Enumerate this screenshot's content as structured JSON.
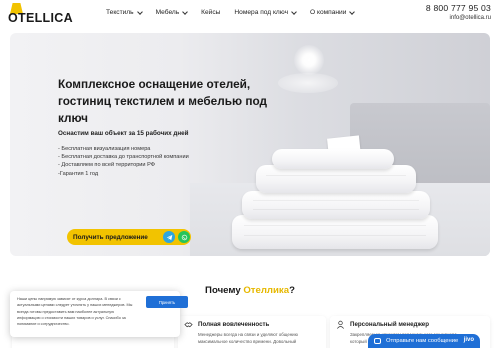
{
  "header": {
    "logo_text": "OTELLICA",
    "nav": [
      {
        "label": "Текстиль",
        "has_dropdown": true
      },
      {
        "label": "Мебель",
        "has_dropdown": true
      },
      {
        "label": "Кейсы",
        "has_dropdown": false
      },
      {
        "label": "Номера под ключ",
        "has_dropdown": true
      },
      {
        "label": "О компании",
        "has_dropdown": true
      }
    ],
    "phone": "8 800 777 95 03",
    "email": "info@otellica.ru"
  },
  "hero": {
    "title": "Комплексное оснащение отелей, гостиниц текстилем и мебелью под ключ",
    "subtitle": "Оснастим ваш объект за 15 рабочих дней",
    "bullets": [
      "- Бесплатная визуализация номера",
      "- Бесплатная доставка до транспортной компании",
      "- Доставляем по всей территории РФ",
      "-Гарантия 1 год"
    ],
    "cta_label": "Получить предложение",
    "colors": {
      "accent": "#f2c300",
      "telegram": "#2ea6dd",
      "whatsapp": "#25c45b"
    }
  },
  "why": {
    "title_prefix": "Почему ",
    "title_brand": "Отеллика",
    "title_suffix": "?",
    "features": [
      {
        "icon": "handshake-icon",
        "title": "Полная вовлеченность",
        "text": "Менеджеры всегда на связи и уделяют общению максимальное количество времени. Довольный"
      },
      {
        "icon": "manager-icon",
        "title": "Персональный менеджер",
        "text": "Закрепляем за клиентом персонального менеджера, который лично контролирует все особенности"
      }
    ]
  },
  "cookie": {
    "text": "Наши цены напрямую зависят от курса доллара. В связи с актуальными ценами следует уточнять у наших менеджеров. Мы всегда готовы предоставить вам наиболее актуальную информацию о стоимости наших товаров и услуг. Спасибо за понимание и сотрудничество.",
    "button": "Принять",
    "button_color": "#1f6fd6"
  },
  "chat": {
    "label": "Отправьте нам сообщение",
    "brand": "jivo"
  }
}
